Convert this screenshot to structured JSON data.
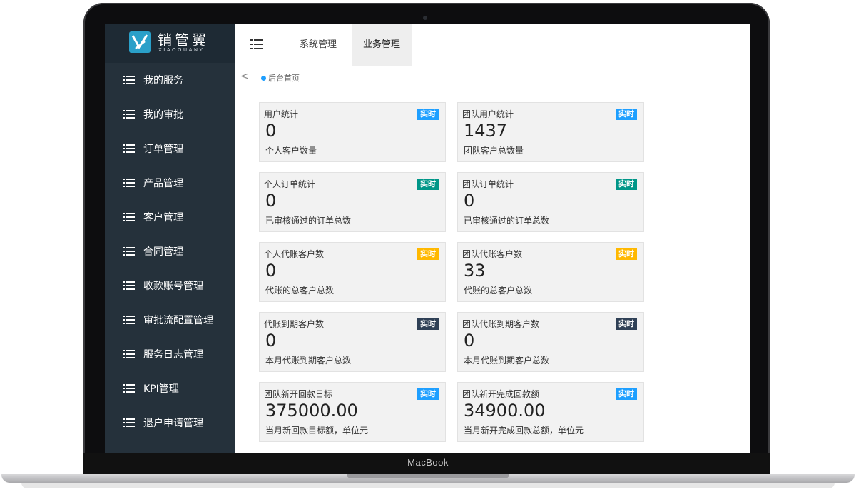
{
  "device": {
    "label": "MacBook"
  },
  "app": {
    "logo": {
      "name": "销管翼",
      "subtitle": "XIAOGUANYI"
    },
    "sidebar": {
      "items": [
        {
          "label": "我的服务"
        },
        {
          "label": "我的审批"
        },
        {
          "label": "订单管理"
        },
        {
          "label": "产品管理"
        },
        {
          "label": "客户管理"
        },
        {
          "label": "合同管理"
        },
        {
          "label": "收款账号管理"
        },
        {
          "label": "审批流配置管理"
        },
        {
          "label": "服务日志管理"
        },
        {
          "label": "KPI管理"
        },
        {
          "label": "退户申请管理"
        }
      ]
    },
    "topbar": {
      "tabs": [
        {
          "label": "系统管理",
          "active": false
        },
        {
          "label": "业务管理",
          "active": true
        }
      ]
    },
    "breadcrumb": {
      "back": "<",
      "current": "后台首页"
    },
    "cards": [
      {
        "title": "用户统计",
        "badge": "实时",
        "badge_color": "#1e9fff",
        "value": "0",
        "desc": "个人客户数量"
      },
      {
        "title": "团队用户统计",
        "badge": "实时",
        "badge_color": "#1e9fff",
        "value": "1437",
        "desc": "团队客户总数量"
      },
      {
        "title": "个人订单统计",
        "badge": "实时",
        "badge_color": "#009688",
        "value": "0",
        "desc": "已审核通过的订单总数"
      },
      {
        "title": "团队订单统计",
        "badge": "实时",
        "badge_color": "#009688",
        "value": "0",
        "desc": "已审核通过的订单总数"
      },
      {
        "title": "个人代账客户数",
        "badge": "实时",
        "badge_color": "#ffb800",
        "value": "0",
        "desc": "代账的总客户总数"
      },
      {
        "title": "团队代账客户数",
        "badge": "实时",
        "badge_color": "#ffb800",
        "value": "33",
        "desc": "代账的总客户总数"
      },
      {
        "title": "代账到期客户数",
        "badge": "实时",
        "badge_color": "#2f4056",
        "value": "0",
        "desc": "本月代账到期客户总数"
      },
      {
        "title": "团队代账到期客户数",
        "badge": "实时",
        "badge_color": "#2f4056",
        "value": "0",
        "desc": "本月代账到期客户总数"
      },
      {
        "title": "团队新开回款日标",
        "badge": "实时",
        "badge_color": "#1e9fff",
        "value": "375000.00",
        "desc": "当月新回款目标额，单位元"
      },
      {
        "title": "团队新开完成回款额",
        "badge": "实时",
        "badge_color": "#1e9fff",
        "value": "34900.00",
        "desc": "当月新开完成回款总额，单位元"
      }
    ]
  }
}
